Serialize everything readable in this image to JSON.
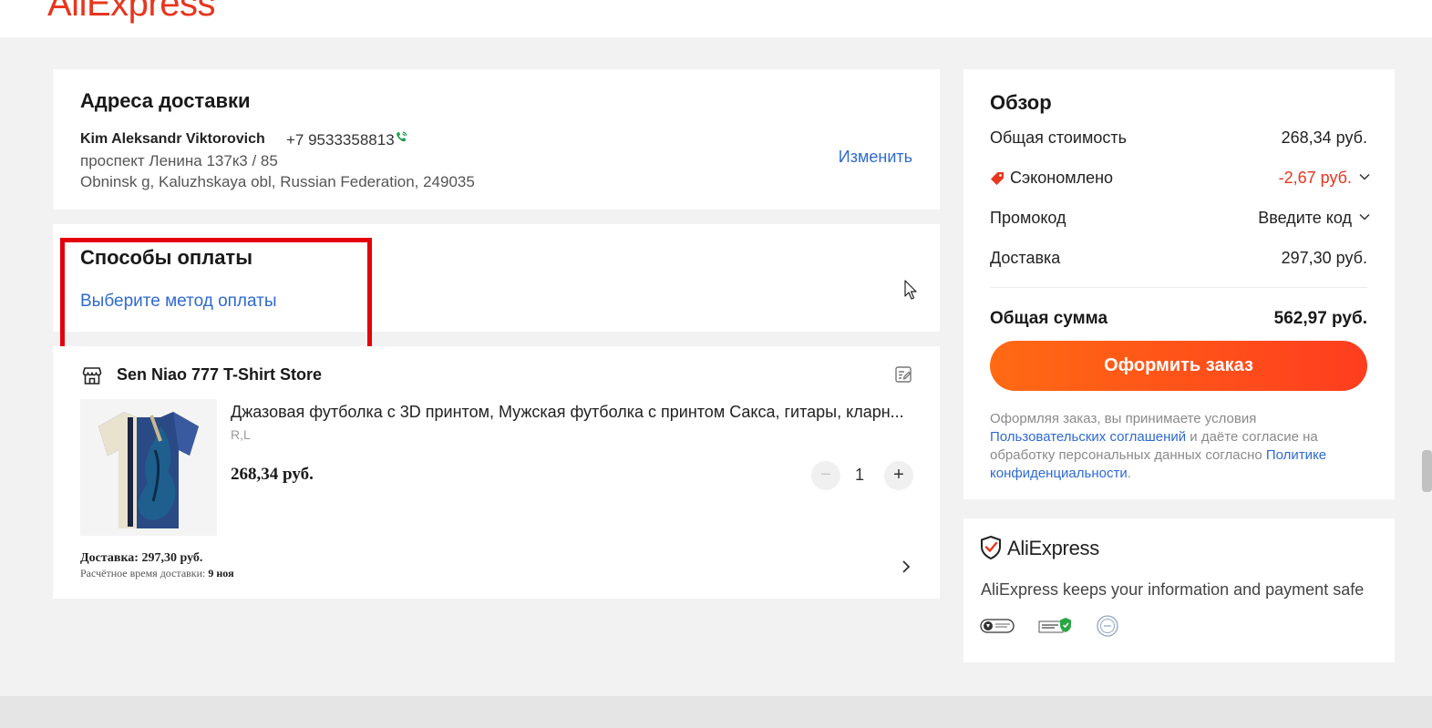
{
  "header": {
    "logo_text": "AliExpress"
  },
  "address": {
    "title": "Адреса доставки",
    "name": "Kim Aleksandr Viktorovich",
    "phone": "+7 9533358813",
    "line1": "проспект Ленина 137к3 / 85",
    "line2": "Obninsk g, Kaluzhskaya obl, Russian Federation, 249035",
    "change_label": "Изменить"
  },
  "payment": {
    "title": "Способы оплаты",
    "select_label": "Выберите метод оплаты"
  },
  "product": {
    "store_name": "Sen Niao 777 T-Shirt Store",
    "title": "Джазовая футболка с 3D принтом, Мужская футболка с принтом Сакса, гитары, кларн...",
    "variant": "R,L",
    "price": "268,34 руб.",
    "quantity": "1",
    "minus_label": "−",
    "plus_label": "+",
    "shipping_label": "Доставка: 297,30 руб.",
    "eta_label": "Расчётное время доставки: ",
    "eta_value": "9 ноя"
  },
  "summary": {
    "title": "Обзор",
    "subtotal_label": "Общая стоимость",
    "subtotal_value": "268,34 руб.",
    "saved_label": "Сэкономлено",
    "saved_value": "-2,67 руб.",
    "promo_label": "Промокод",
    "promo_value": "Введите код",
    "shipping_label": "Доставка",
    "shipping_value": "297,30 руб.",
    "total_label": "Общая сумма",
    "total_value": "562,97 руб.",
    "order_button": "Оформить заказ",
    "terms_prefix": "Оформляя заказ, вы принимаете условия ",
    "terms_link1": "Пользовательских соглашений",
    "terms_middle": " и даёте согласие на обработку персональных данных согласно ",
    "terms_link2": "Политике конфиденциальности",
    "terms_suffix": "."
  },
  "safe": {
    "brand": "AliExpress",
    "text": "AliExpress keeps your information and payment safe"
  },
  "colors": {
    "brand": "#e8351e",
    "link": "#2e6ad1",
    "button_from": "#ff6a13",
    "button_to": "#ff3d1f",
    "highlight": "#e3000b"
  }
}
